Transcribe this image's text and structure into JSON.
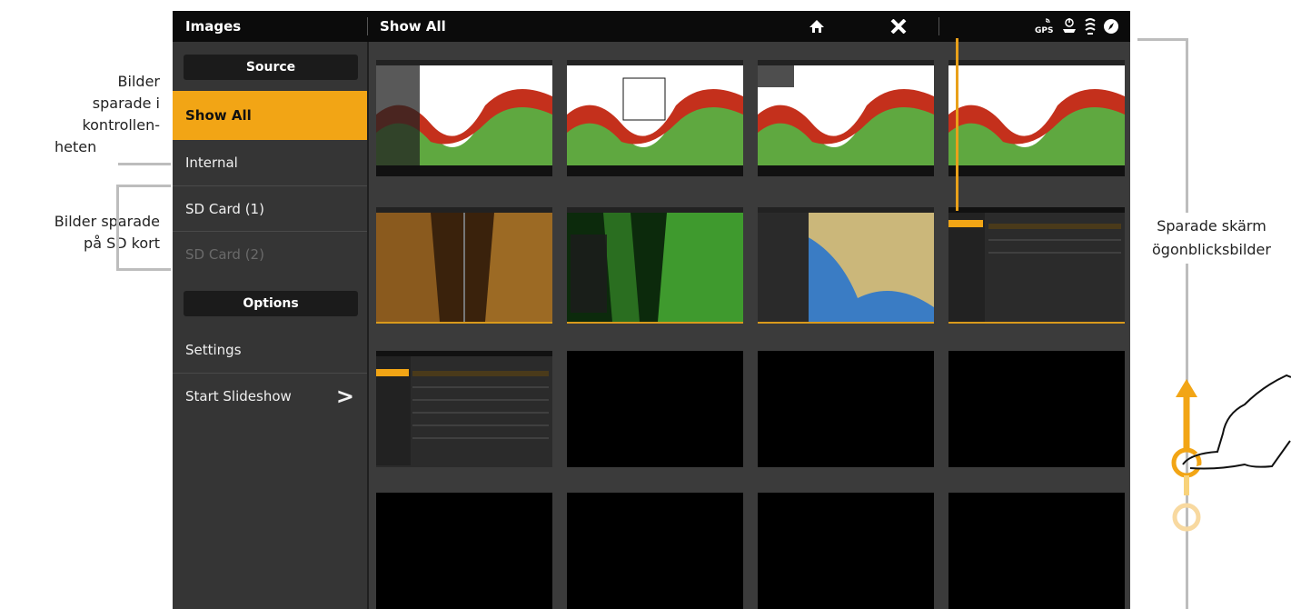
{
  "window": {
    "title": "Images",
    "subtitle": "Show All"
  },
  "topbar_icons": [
    "home-icon",
    "close-icon",
    "gps-icon",
    "power-eject-icon",
    "sonar-icon",
    "compass-icon"
  ],
  "topbar_gps_text": "GPS",
  "sidebar": {
    "source_header": "Source",
    "items": [
      {
        "label": "Show All",
        "state": "active"
      },
      {
        "label": "Internal",
        "state": "normal"
      },
      {
        "label": "SD Card (1)",
        "state": "normal"
      },
      {
        "label": "SD Card (2)",
        "state": "disabled"
      }
    ],
    "options_header": "Options",
    "options": [
      {
        "label": "Settings"
      },
      {
        "label": "Start Slideshow",
        "chevron": ">"
      }
    ]
  },
  "annotations": {
    "internal": "Bilder sparade i kontrollen- heten",
    "internal_lines": [
      "Bilder",
      "sparade i",
      "kontrollen-",
      "heten"
    ],
    "sdcard_lines": [
      "Bilder sparade",
      "på SD kort"
    ],
    "screenshots_lines": [
      "Sparade skärm",
      "ögonblicksbilder"
    ]
  },
  "colors": {
    "accent": "#f2a515",
    "screen_bg": "#3b3b3b",
    "topbar_bg": "#0b0b0b"
  }
}
